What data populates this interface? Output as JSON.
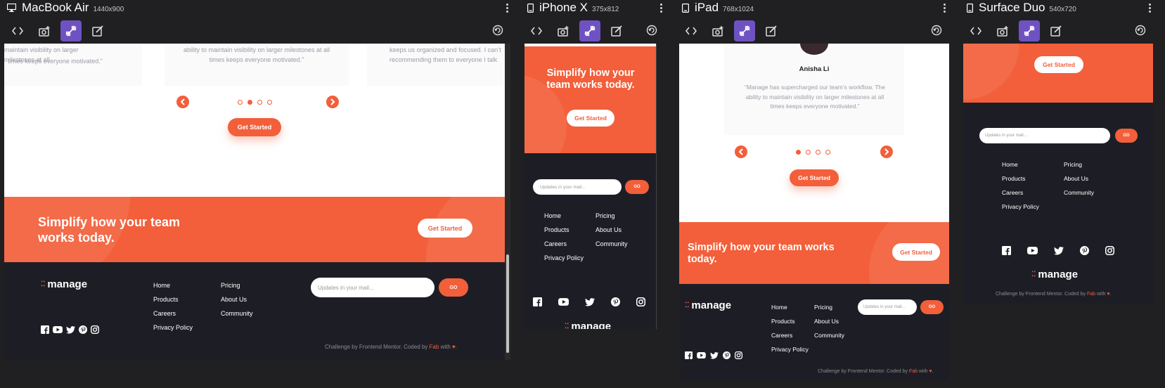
{
  "devices": [
    {
      "name": "MacBook Air",
      "size": "1440x900"
    },
    {
      "name": "iPhone X",
      "size": "375x812"
    },
    {
      "name": "iPad",
      "size": "768x1024"
    },
    {
      "name": "Surface Duo",
      "size": "540x720"
    }
  ],
  "tools": [
    "code-icon",
    "screenshot-icon",
    "sync-icon",
    "edit-icon",
    "rotate-icon"
  ],
  "site": {
    "quote_text": "“Manage has supercharged our team’s workflow. The ability to maintain visibility on larger milestones at all times keeps everyone motivated.”",
    "quote_partial_left_1": "maintain visibility on larger milestones at all",
    "quote_partial_left_2": "times keeps everyone motivated.”",
    "quote_mid_1": "ability to maintain visibility on larger milestones at all",
    "quote_mid_2": "times keeps everyone motivated.”",
    "quote_right_1": "keeps us organized and focused. I can’t",
    "quote_right_2": "recommending them to everyone I talk",
    "reviewer": "Anisha Li",
    "get_started": "Get Started",
    "cta_title": "Simplify how your team works today.",
    "cta_title_l1": "Simplify how your team",
    "cta_title_l2": "works today.",
    "cta_phone_l1": "Simplify how your",
    "cta_phone_l2": "team works today.",
    "cta_ipad_l1": "Simplify how your team works",
    "cta_ipad_l2": "today.",
    "logo": "manage",
    "nav": {
      "home": "Home",
      "products": "Products",
      "careers": "Careers",
      "privacy": "Privacy Policy",
      "pricing": "Pricing",
      "about": "About Us",
      "community": "Community"
    },
    "email_placeholder": "Updates in your mail...",
    "go": "GO",
    "credit_prefix": "Challenge by Frontend Mentor. Coded by ",
    "credit_author": "Fab",
    "credit_suffix": " with ",
    "credit_heart": "♥",
    "credit_end": ".",
    "carousel_active_index": 1,
    "carousel_count": 4
  },
  "colors": {
    "accent": "#f25f3a",
    "dark": "#1d1e25",
    "toolbar_active": "#6f52c2",
    "bg": "#202023"
  },
  "social_icons": [
    "facebook-icon",
    "youtube-icon",
    "twitter-icon",
    "pinterest-icon",
    "instagram-icon"
  ]
}
